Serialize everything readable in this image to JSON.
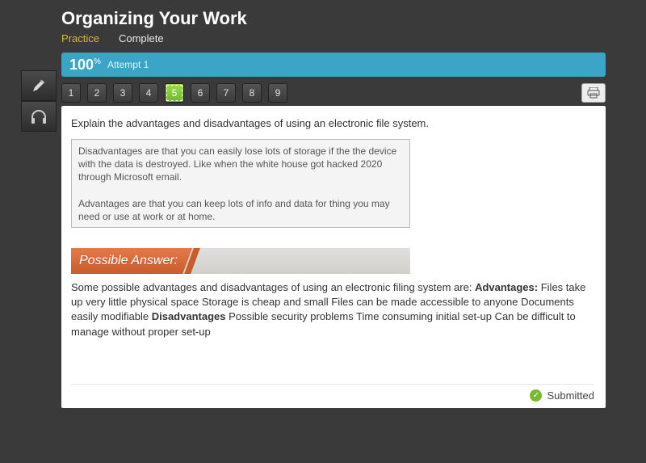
{
  "header": {
    "title": "Organizing Your Work",
    "tabs": {
      "practice": "Practice",
      "complete": "Complete"
    }
  },
  "progress": {
    "percent_value": "100",
    "percent_unit": "%",
    "attempt": "Attempt 1"
  },
  "questions": {
    "items": [
      "1",
      "2",
      "3",
      "4",
      "5",
      "6",
      "7",
      "8",
      "9"
    ],
    "active_index": 4
  },
  "main": {
    "prompt": "Explain the advantages and disadvantages of using an electronic file system.",
    "response": "Disadvantages are that you can easily lose lots of storage if the the device with the data is destroyed. Like when the white house got hacked 2020 through Microsoft email.\n\nAdvantages are that you can keep lots of info and data for thing you may need or use at work or at home.",
    "possible_header": "Possible Answer:",
    "possible_prefix": "Some possible advantages and disadvantages of using an electronic filing system are: ",
    "adv_label": "Advantages:",
    "adv_text": " Files take up very little physical space Storage is cheap and small Files can be made accessible to anyone Documents easily modifiable ",
    "dis_label": "Disadvantages",
    "dis_text": " Possible security problems Time consuming initial set-up Can be difficult to manage without proper set-up"
  },
  "footer": {
    "status": "Submitted"
  }
}
